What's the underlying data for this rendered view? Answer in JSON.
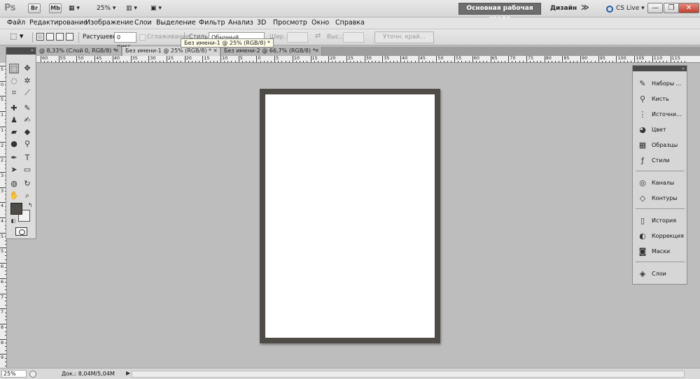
{
  "app": {
    "logo": "Ps",
    "chips": [
      "Br",
      "Mb"
    ],
    "zoom": "25%",
    "workspace_active": "Основная рабочая среда",
    "workspace_design": "Дизайн",
    "more": "≫",
    "cs_live": "CS Live",
    "window_buttons": [
      "—",
      "❐",
      "✕"
    ]
  },
  "menu": [
    "Файл",
    "Редактирование",
    "Изображение",
    "Слои",
    "Выделение",
    "Фильтр",
    "Анализ",
    "3D",
    "Просмотр",
    "Окно",
    "Справка"
  ],
  "options": {
    "feather_label": "Растушевка:",
    "feather_value": "0 пикс.",
    "antialias_label": "Сглаживание",
    "style_label": "Стиль:",
    "style_value": "Обычный",
    "width_label": "Шир.:",
    "height_label": "Выс.:",
    "refine_button": "Уточн. край..."
  },
  "tabs": [
    {
      "label": "@ 8,33% (Слой 0, RGB/8) *",
      "close": "✕"
    },
    {
      "label": "Без имени-1 @ 25% (RGB/8) *",
      "close": "✕"
    },
    {
      "label": "Без имени-2 @ 66,7% (RGB/8) *",
      "close": "✕"
    }
  ],
  "tooltip": "Без имени-1 @ 25% (RGB/8) *",
  "ruler_numbers": [
    "60",
    "55",
    "50",
    "45",
    "40",
    "35",
    "30",
    "25",
    "20",
    "15",
    "10",
    "5",
    "0",
    "5",
    "10",
    "15",
    "20",
    "25",
    "30",
    "35",
    "40",
    "45",
    "50",
    "55",
    "60",
    "65",
    "70",
    "75",
    "80",
    "85",
    "90",
    "95",
    "100",
    "105",
    "110",
    "115"
  ],
  "vruler_numbers": [
    "5",
    "0",
    "5",
    "1",
    "1",
    "2",
    "2",
    "3",
    "3",
    "4",
    "4",
    "5",
    "5",
    "6",
    "6",
    "7",
    "7",
    "8",
    "8",
    "9"
  ],
  "panels": [
    {
      "label": "Наборы ...",
      "icon": "brush-presets-icon",
      "glyph": "✎"
    },
    {
      "label": "Кисть",
      "icon": "brush-icon",
      "glyph": "⚲"
    },
    {
      "label": "Источни...",
      "icon": "clone-source-icon",
      "glyph": "⋮"
    },
    {
      "label": "Цвет",
      "icon": "color-icon",
      "glyph": "◕"
    },
    {
      "label": "Образцы",
      "icon": "swatches-icon",
      "glyph": "▦"
    },
    {
      "label": "Стили",
      "icon": "styles-icon",
      "glyph": "ƒ"
    },
    {
      "label": "Каналы",
      "icon": "channels-icon",
      "glyph": "◎"
    },
    {
      "label": "Контуры",
      "icon": "paths-icon",
      "glyph": "◇"
    },
    {
      "label": "История",
      "icon": "history-icon",
      "glyph": "▯"
    },
    {
      "label": "Коррекция",
      "icon": "adjustments-icon",
      "glyph": "◐"
    },
    {
      "label": "Маски",
      "icon": "masks-icon",
      "glyph": "◙"
    },
    {
      "label": "Слои",
      "icon": "layers-icon",
      "glyph": "◈"
    }
  ],
  "status": {
    "zoom": "25%",
    "doc": "Док.: 8,04M/5,04M",
    "arrow": "▶"
  },
  "colors": {
    "foreground": "#4f4b47",
    "background": "#f2f2f2",
    "workspace": "#bdbdbd",
    "document_frame": "#4f4b47"
  }
}
